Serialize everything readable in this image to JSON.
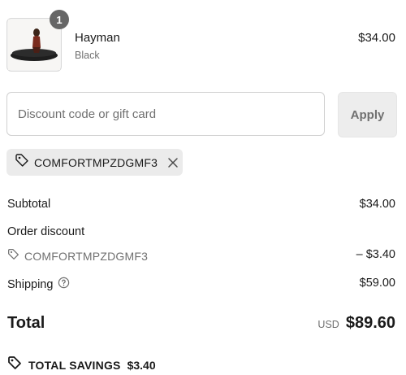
{
  "product": {
    "name": "Hayman",
    "variant": "Black",
    "price": "$34.00",
    "quantity": "1",
    "image_icon": "product-thumbnail"
  },
  "discount": {
    "placeholder": "Discount code or gift card",
    "value": "",
    "apply_label": "Apply"
  },
  "applied_code": {
    "code": "COMFORTMPZDGMF3",
    "tag_icon": "tag-icon",
    "remove_icon": "close-icon"
  },
  "summary": {
    "subtotal_label": "Subtotal",
    "subtotal_value": "$34.00",
    "order_discount_label": "Order discount",
    "order_discount_code": "COMFORTMPZDGMF3",
    "order_discount_value": "– $3.40",
    "shipping_label": "Shipping",
    "shipping_value": "$59.00",
    "shipping_info_icon": "question-circle-icon"
  },
  "total": {
    "label": "Total",
    "currency": "USD",
    "amount": "$89.60"
  },
  "savings": {
    "label": "TOTAL SAVINGS",
    "amount": "$3.40",
    "icon": "tag-icon"
  },
  "colors": {
    "text": "#1a1a1a",
    "muted": "#707070",
    "chip_bg": "#ebebeb",
    "badge_bg": "#666666",
    "border": "#d0d0d0"
  }
}
